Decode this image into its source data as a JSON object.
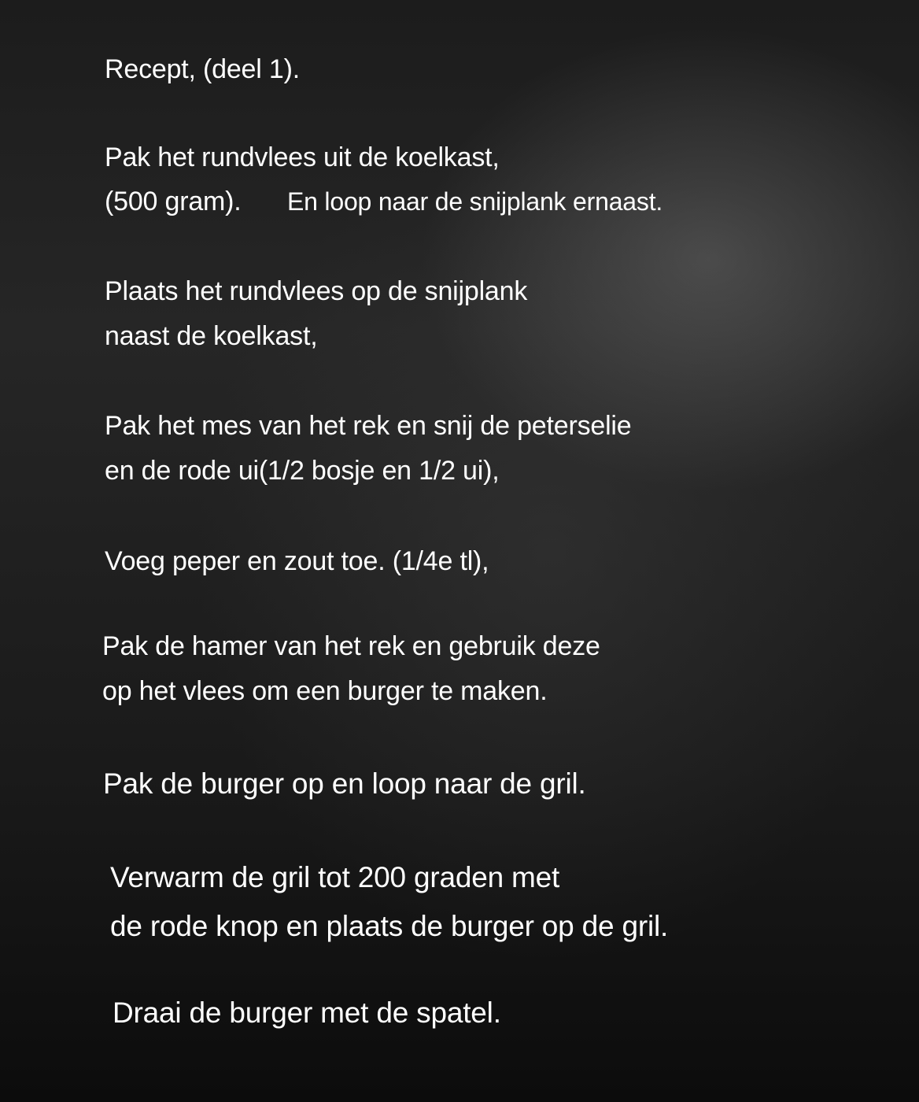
{
  "title": "Recept, (deel 1).",
  "steps": [
    {
      "lines": [
        "Pak het rundvlees uit de koelkast,",
        "(500 gram).",
        "En loop naar de snijplank ernaast."
      ]
    },
    {
      "lines": [
        "Plaats het rundvlees op de snijplank",
        "naast de koelkast,"
      ]
    },
    {
      "lines": [
        "Pak het mes van het rek en snij de peterselie",
        "en de rode ui(1/2 bosje en 1/2 ui),"
      ]
    },
    {
      "lines": [
        "Voeg peper en zout toe. (1/4e tl),"
      ]
    },
    {
      "lines": [
        "Pak de hamer van het rek en gebruik deze",
        "op het vlees om een burger te maken."
      ]
    },
    {
      "lines": [
        "Pak de burger op en loop naar de gril."
      ]
    },
    {
      "lines": [
        "Verwarm de gril tot 200 graden met",
        "de rode knop en plaats de burger op de gril."
      ]
    },
    {
      "lines": [
        "Draai de burger met de spatel."
      ]
    }
  ],
  "colors": {
    "text": "#ffffff",
    "background": "#1c1c1c"
  }
}
